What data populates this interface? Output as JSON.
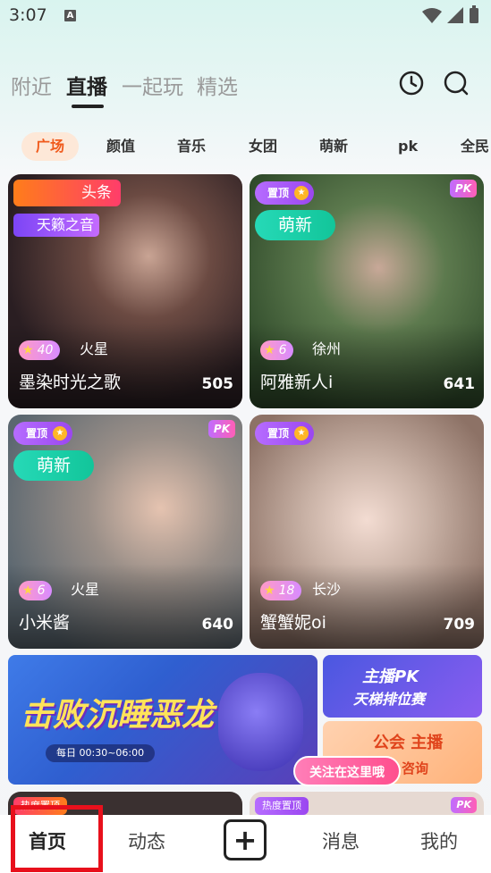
{
  "status_bar": {
    "time": "3:07",
    "notification_glyph": "A"
  },
  "top_tabs": [
    {
      "label": "附近"
    },
    {
      "label": "直播"
    },
    {
      "label": "一起玩"
    },
    {
      "label": "精选"
    }
  ],
  "categories": [
    "广场",
    "颜值",
    "音乐",
    "女团",
    "萌新",
    "pk",
    "全民"
  ],
  "cards": [
    {
      "name": "墨染时光之歌",
      "count": "505",
      "level": "40",
      "location": "火星",
      "badge_top": "头条",
      "badge_second": "天籁之音",
      "bg": "#3a2a2c"
    },
    {
      "name": "阿雅新人i",
      "count": "641",
      "level": "6",
      "location": "徐州",
      "badge_top": "置顶",
      "badge_second": "萌新",
      "pk": "PK",
      "bg": "#4e6a44"
    },
    {
      "name": "小米酱",
      "count": "640",
      "level": "6",
      "location": "火星",
      "badge_top": "置顶",
      "badge_second": "萌新",
      "pk": "PK",
      "bg": "#7e8b93"
    },
    {
      "name": "蟹蟹妮oi",
      "count": "709",
      "level": "18",
      "location": "长沙",
      "badge_top": "置顶",
      "bg": "#d9cfc8"
    }
  ],
  "banners": {
    "main_title": "击败沉睡恶龙",
    "main_time": "每日 00:30~06:00",
    "pk_title": "主播PK",
    "pk_sub": "天梯排位赛",
    "anchor_title": "公会 主播",
    "anchor_sub": "咨询",
    "follow": "关注在这里哦"
  },
  "bottom_row": {
    "left_badge": "热度置顶",
    "right_badge": "热度置顶",
    "right_pk": "PK"
  },
  "bottom_nav": [
    {
      "label": "首页"
    },
    {
      "label": "动态"
    },
    {
      "label": "+"
    },
    {
      "label": "消息"
    },
    {
      "label": "我的"
    }
  ]
}
